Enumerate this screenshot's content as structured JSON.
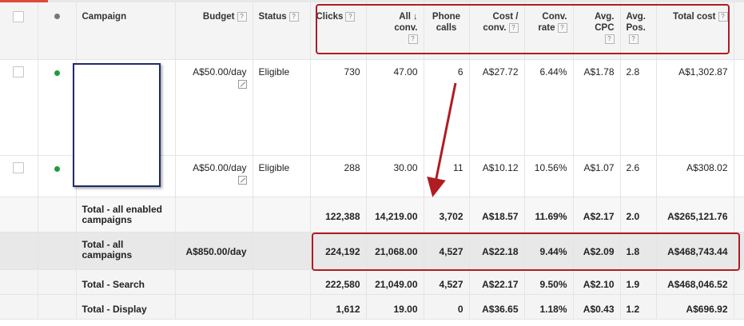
{
  "headers": {
    "campaign": "Campaign",
    "budget": "Budget",
    "status": "Status",
    "clicks": "Clicks",
    "all_conv_1": "All",
    "all_conv_2": "conv.",
    "phone_1": "Phone",
    "phone_2": "calls",
    "cost_conv_1": "Cost /",
    "cost_conv_2": "conv.",
    "conv_rate_1": "Conv.",
    "conv_rate_2": "rate",
    "avg_cpc_1": "Avg.",
    "avg_cpc_2": "CPC",
    "avg_pos_1": "Avg.",
    "avg_pos_2": "Pos.",
    "total_cost": "Total cost",
    "help": "?",
    "sort_arrow": "↓"
  },
  "rows": [
    {
      "budget": "A$50.00/day",
      "status": "Eligible",
      "clicks": "730",
      "all_conv": "47.00",
      "phone_calls": "6",
      "cost_conv": "A$27.72",
      "conv_rate": "6.44%",
      "avg_cpc": "A$1.78",
      "avg_pos": "2.8",
      "total_cost": "A$1,302.87"
    },
    {
      "budget": "A$50.00/day",
      "status": "Eligible",
      "clicks": "288",
      "all_conv": "30.00",
      "phone_calls": "11",
      "cost_conv": "A$10.12",
      "conv_rate": "10.56%",
      "avg_cpc": "A$1.07",
      "avg_pos": "2.6",
      "total_cost": "A$308.02"
    }
  ],
  "totals": [
    {
      "label_1": "Total - all enabled",
      "label_2": "campaigns",
      "budget": "",
      "clicks": "122,388",
      "all_conv": "14,219.00",
      "phone_calls": "3,702",
      "cost_conv": "A$18.57",
      "conv_rate": "11.69%",
      "avg_cpc": "A$2.17",
      "avg_pos": "2.0",
      "total_cost": "A$265,121.76"
    },
    {
      "label_1": "Total - all",
      "label_2": "campaigns",
      "budget": "A$850.00/day",
      "clicks": "224,192",
      "all_conv": "21,068.00",
      "phone_calls": "4,527",
      "cost_conv": "A$22.18",
      "conv_rate": "9.44%",
      "avg_cpc": "A$2.09",
      "avg_pos": "1.8",
      "total_cost": "A$468,743.44"
    },
    {
      "label_1": "Total - Search",
      "label_2": "",
      "budget": "",
      "clicks": "222,580",
      "all_conv": "21,049.00",
      "phone_calls": "4,527",
      "cost_conv": "A$22.17",
      "conv_rate": "9.50%",
      "avg_cpc": "A$2.10",
      "avg_pos": "1.9",
      "total_cost": "A$468,046.52"
    },
    {
      "label_1": "Total - Display",
      "label_2": "",
      "budget": "",
      "clicks": "1,612",
      "all_conv": "19.00",
      "phone_calls": "0",
      "cost_conv": "A$36.65",
      "conv_rate": "1.18%",
      "avg_cpc": "A$0.43",
      "avg_pos": "1.2",
      "total_cost": "A$696.92"
    }
  ],
  "colors": {
    "status_dot": "#1e9b42",
    "annotation_red": "#b01c22",
    "redaction_border": "#1f2a6a",
    "sorted_header_bg": "#e0e0e0"
  },
  "icons": {
    "checkbox": "checkbox-icon",
    "status_dot": "status-dot-icon",
    "edit_budget": "edit-icon",
    "help": "help-icon",
    "sort": "sort-desc-icon"
  }
}
